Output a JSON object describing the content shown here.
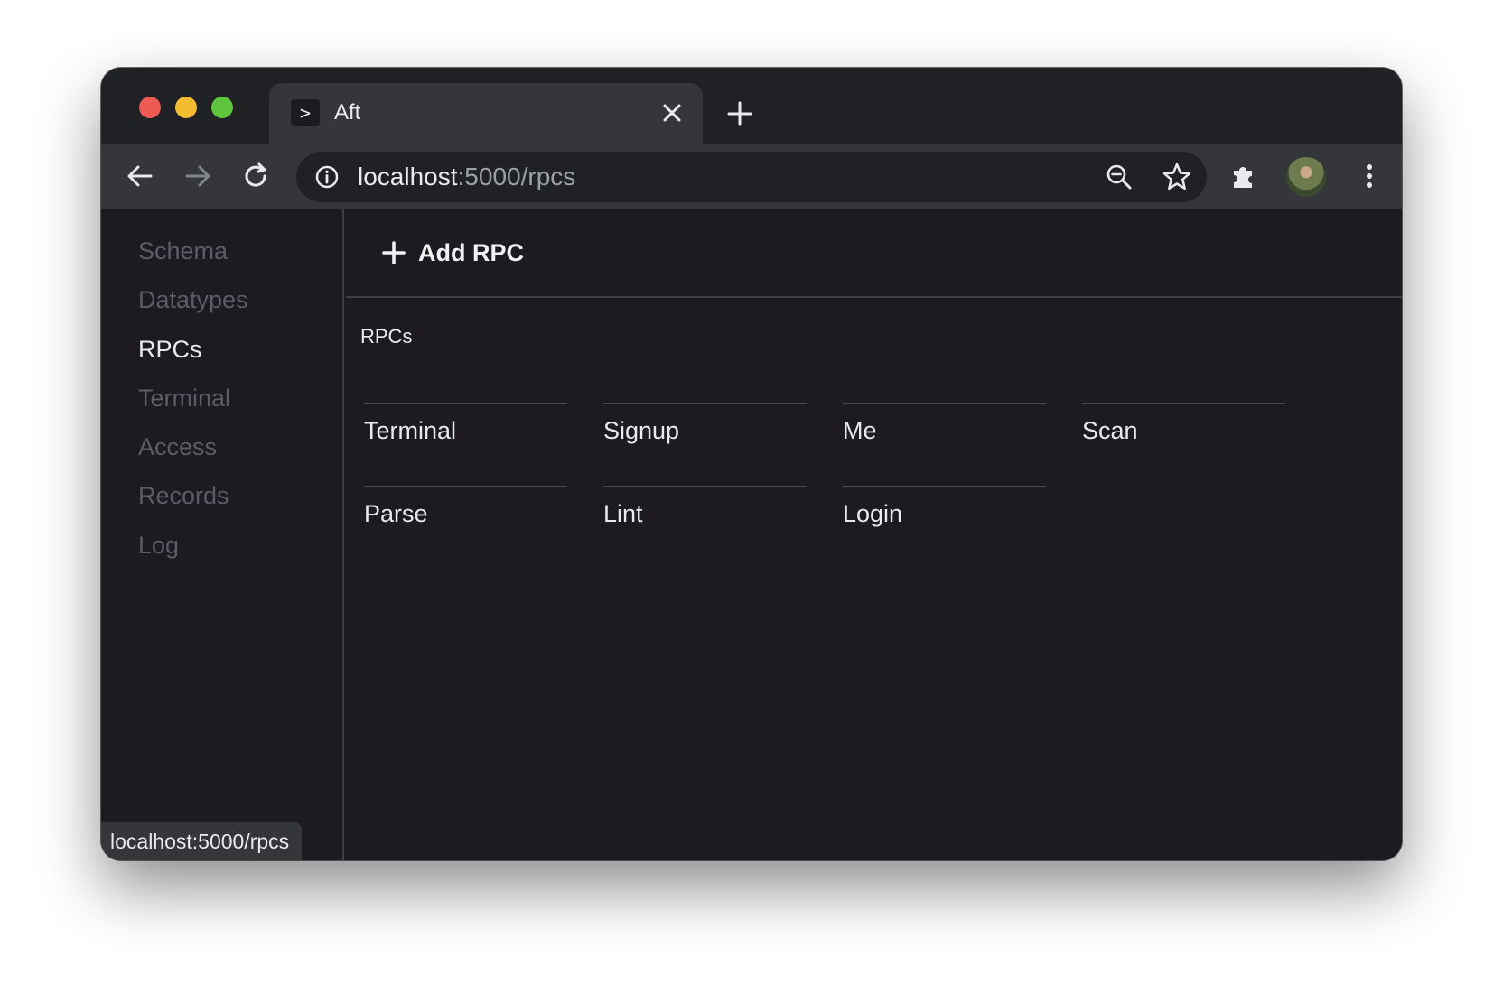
{
  "browser": {
    "tab": {
      "favicon_glyph": ">",
      "title": "Aft"
    },
    "omnibox": {
      "url_host": "localhost",
      "url_rest": ":5000/rpcs"
    },
    "status_text": "localhost:5000/rpcs"
  },
  "sidebar": {
    "items": [
      {
        "label": "Schema",
        "active": false
      },
      {
        "label": "Datatypes",
        "active": false
      },
      {
        "label": "RPCs",
        "active": true
      },
      {
        "label": "Terminal",
        "active": false
      },
      {
        "label": "Access",
        "active": false
      },
      {
        "label": "Records",
        "active": false
      },
      {
        "label": "Log",
        "active": false
      }
    ]
  },
  "main": {
    "add_button_label": "Add RPC",
    "section_title": "RPCs",
    "rpcs": [
      "Terminal",
      "Signup",
      "Me",
      "Scan",
      "Parse",
      "Lint",
      "Login"
    ]
  },
  "colors": {
    "content_bg": "#1d1b21",
    "chrome_bg": "#35363a",
    "nav_inactive": "#5c5b66",
    "text": "#e8eaed"
  }
}
